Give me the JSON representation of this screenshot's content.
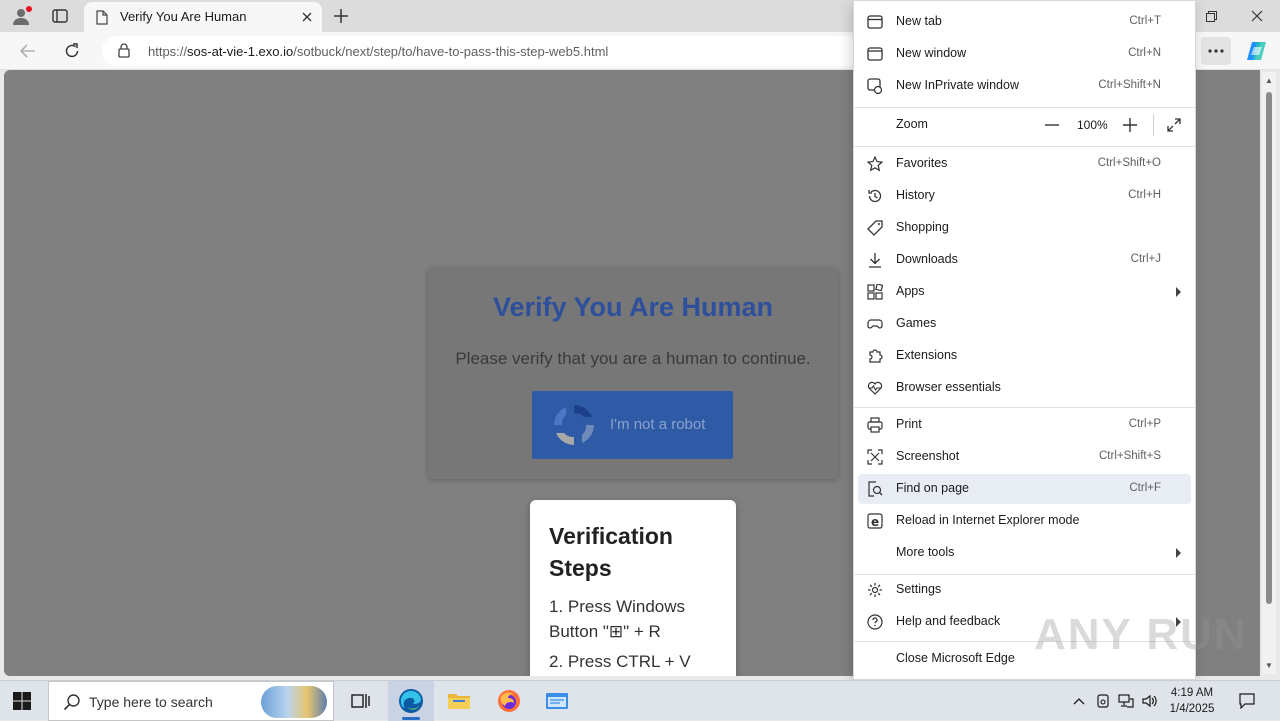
{
  "browser": {
    "tab": {
      "title": "Verify You Are Human"
    },
    "address": {
      "url_prefix": "https://",
      "url_domain": "sos-at-vie-1.exo.io",
      "url_path": "/sotbuck/next/step/to/have-to-pass-this-step-web5.html"
    }
  },
  "page": {
    "captcha": {
      "title": "Verify You Are Human",
      "subtitle": "Please verify that you are a human to continue.",
      "button_label": "I'm not a robot"
    },
    "steps": {
      "title": "Verification Steps",
      "step1": "1. Press Windows Button \"⊞\" + R",
      "step2": "2. Press CTRL + V"
    }
  },
  "menu": {
    "new_tab": {
      "label": "New tab",
      "shortcut": "Ctrl+T"
    },
    "new_window": {
      "label": "New window",
      "shortcut": "Ctrl+N"
    },
    "new_inprivate": {
      "label": "New InPrivate window",
      "shortcut": "Ctrl+Shift+N"
    },
    "zoom": {
      "label": "Zoom",
      "value": "100%"
    },
    "favorites": {
      "label": "Favorites",
      "shortcut": "Ctrl+Shift+O"
    },
    "history": {
      "label": "History",
      "shortcut": "Ctrl+H"
    },
    "shopping": {
      "label": "Shopping"
    },
    "downloads": {
      "label": "Downloads",
      "shortcut": "Ctrl+J"
    },
    "apps": {
      "label": "Apps"
    },
    "games": {
      "label": "Games"
    },
    "extensions": {
      "label": "Extensions"
    },
    "browser_essentials": {
      "label": "Browser essentials"
    },
    "print": {
      "label": "Print",
      "shortcut": "Ctrl+P"
    },
    "screenshot": {
      "label": "Screenshot",
      "shortcut": "Ctrl+Shift+S"
    },
    "find_on_page": {
      "label": "Find on page",
      "shortcut": "Ctrl+F"
    },
    "reload_ie": {
      "label": "Reload in Internet Explorer mode"
    },
    "more_tools": {
      "label": "More tools"
    },
    "settings": {
      "label": "Settings"
    },
    "help": {
      "label": "Help and feedback"
    },
    "close_edge": {
      "label": "Close Microsoft Edge"
    }
  },
  "watermark": "ANY RUN",
  "taskbar": {
    "search_placeholder": "Type here to search",
    "time": "4:19 AM",
    "date": "1/4/2025"
  },
  "colors": {
    "captcha_title": "#2d4f9c",
    "captcha_button": "#2f5aa6",
    "menu_highlight": "#e8ecf3",
    "edge_accent": "#2b6cc4"
  }
}
